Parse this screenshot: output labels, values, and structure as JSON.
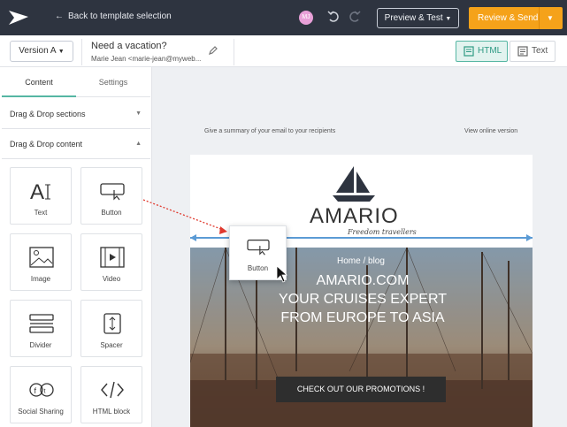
{
  "topbar": {
    "back_label": "Back to template selection",
    "avatar_initials": "MJ",
    "preview_label": "Preview & Test",
    "review_label": "Review & Send",
    "accent": "#f5a21a"
  },
  "subbar": {
    "version_label": "Version A",
    "subject": "Need a vacation?",
    "sender": "Marie Jean <marie-jean@myweb...",
    "html_label": "HTML",
    "text_label": "Text"
  },
  "left": {
    "tabs": [
      {
        "label": "Content"
      },
      {
        "label": "Settings"
      }
    ],
    "sections": [
      {
        "label": "Drag & Drop sections"
      },
      {
        "label": "Drag & Drop content"
      }
    ],
    "blocks": [
      {
        "label": "Text",
        "icon": "text-icon"
      },
      {
        "label": "Button",
        "icon": "button-icon"
      },
      {
        "label": "Image",
        "icon": "image-icon"
      },
      {
        "label": "Video",
        "icon": "video-icon"
      },
      {
        "label": "Divider",
        "icon": "divider-icon"
      },
      {
        "label": "Spacer",
        "icon": "spacer-icon"
      },
      {
        "label": "Social Sharing",
        "icon": "social-icon"
      },
      {
        "label": "HTML block",
        "icon": "code-icon"
      }
    ]
  },
  "canvas": {
    "summary_text": "Give a summary of your email to your recipients",
    "view_online": "View online version",
    "brand": "AMARIO",
    "tagline": "Freedom travellers",
    "breadcrumb": "Home / blog",
    "headline": [
      "AMARIO.COM",
      "YOUR CRUISES EXPERT",
      "FROM EUROPE TO ASIA"
    ],
    "promo_label": "CHECK OUT OUR PROMOTIONS !",
    "dragged_label": "Button"
  }
}
